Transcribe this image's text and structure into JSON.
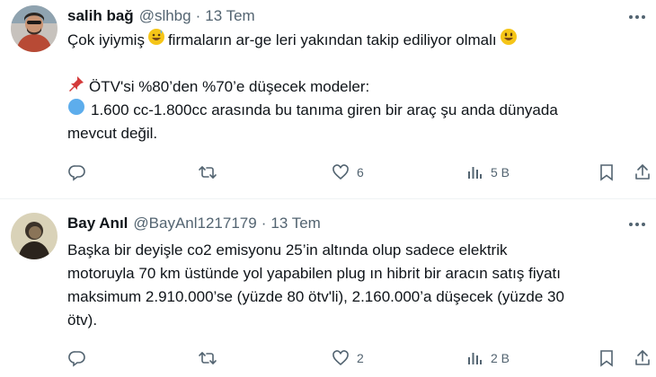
{
  "tweets": [
    {
      "name": "salih bağ",
      "handle": "@slhbg",
      "dot": "·",
      "time": "13 Tem",
      "line1_a": "Çok iyiymiş",
      "line1_b": "firmaların ar-ge leri yakından takip ediliyor olmalı",
      "line2": "ÖTV'si %80’den %70’e düşecek modeler:",
      "line3": "1.600 cc-1.800cc arasında bu tanıma giren bir araç şu anda dünyada",
      "line4": "mevcut değil.",
      "likes": "6",
      "views": "5 B",
      "colors": {
        "avatar_bg": "#b84a35",
        "sweat_emoji": "#f5c518",
        "pin": "#d43a3a",
        "blue_circle": "#5dadec"
      }
    },
    {
      "name": "Bay Anıl",
      "handle": "@BayAnl1217179",
      "dot": "·",
      "time": "13 Tem",
      "line1": "Başka bir deyişle co2 emisyonu 25’in altında olup sadece elektrik",
      "line2": "motoruyla 70 km üstünde yol yapabilen plug ın hibrit bir aracın satış fiyatı",
      "line3": "maksimum 2.910.000’se (yüzde 80 ötv'li), 2.160.000’a düşecek (yüzde 30",
      "line4": "ötv).",
      "likes": "2",
      "views": "2 B",
      "colors": {
        "avatar_bg": "#d9d2b8"
      }
    }
  ],
  "icons": [
    "more-icon",
    "reply-icon",
    "retweet-icon",
    "like-icon",
    "views-icon",
    "bookmark-icon",
    "share-icon",
    "grinning-sweat-emoji",
    "smiley-emoji",
    "pushpin-emoji",
    "blue-circle-emoji"
  ]
}
